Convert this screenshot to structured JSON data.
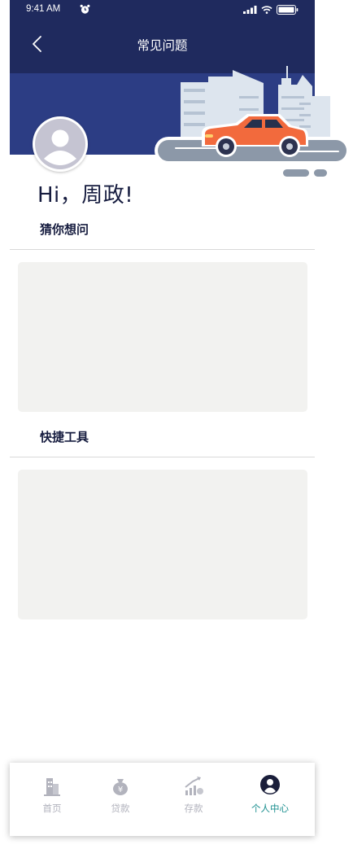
{
  "status_bar": {
    "time": "9:41 AM"
  },
  "header": {
    "title": "常见问题"
  },
  "profile": {
    "greeting": "Hi，周政!"
  },
  "sections": [
    {
      "title": "猜你想问"
    },
    {
      "title": "快捷工具"
    }
  ],
  "tabbar": {
    "items": [
      {
        "label": "首页",
        "icon": "building-icon",
        "active": false
      },
      {
        "label": "贷款",
        "icon": "money-bag-icon",
        "active": false
      },
      {
        "label": "存款",
        "icon": "growth-chart-icon",
        "active": false
      },
      {
        "label": "个人中心",
        "icon": "user-circle-icon",
        "active": true
      }
    ]
  },
  "colors": {
    "nav_bg": "#1f2a5e",
    "banner_bg": "#2c3d84",
    "active_tab": "#1b8f8f",
    "inactive_tab": "#b2b3bd",
    "card_bg": "#f2f2f0"
  }
}
